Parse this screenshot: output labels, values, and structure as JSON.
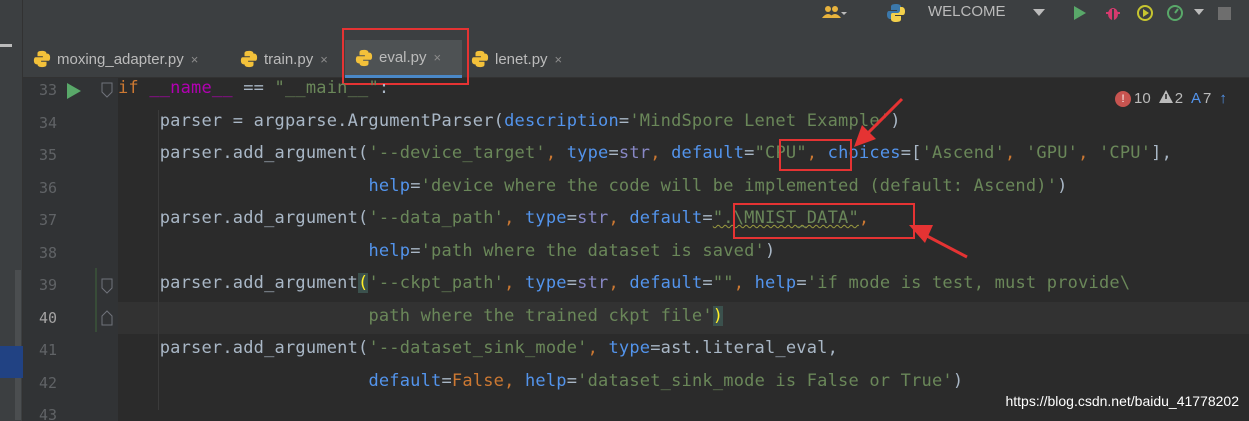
{
  "toolbar": {
    "run_config": "WELCOME"
  },
  "tabs": [
    {
      "label": "moxing_adapter.py",
      "close": "×"
    },
    {
      "label": "train.py",
      "close": "×"
    },
    {
      "label": "eval.py",
      "close": "×"
    },
    {
      "label": "lenet.py",
      "close": "×"
    }
  ],
  "inspections": {
    "errors": "10",
    "warnings": "2",
    "typos": "7"
  },
  "line_numbers": [
    "33",
    "34",
    "35",
    "36",
    "37",
    "38",
    "39",
    "40",
    "41",
    "42",
    "43"
  ],
  "code": {
    "l33": {
      "a": "if ",
      "b": "__name__",
      "c": " == ",
      "d": "\"__main__\"",
      "e": ":"
    },
    "l34": {
      "a": "    parser = argparse.ArgumentParser(",
      "b": "description",
      "c": "=",
      "d": "'MindSpore Lenet Example'",
      "e": ")"
    },
    "l35": {
      "a": "    parser.add_argument(",
      "b": "'--device_target'",
      "c": ", ",
      "d": "type",
      "e": "=",
      "f": "str",
      "g": ", ",
      "h": "default",
      "i": "=",
      "j": "\"CPU\"",
      "k": ", ",
      "l": "choices",
      "m": "=[",
      "n": "'Ascend'",
      "o": ", ",
      "p": "'GPU'",
      "q": ", ",
      "r": "'CPU'",
      "s": "],"
    },
    "l36": {
      "a": "                        ",
      "b": "help",
      "c": "=",
      "d": "'device where the code will be implemented (default: Ascend)'",
      "e": ")"
    },
    "l37": {
      "a": "    parser.add_argument(",
      "b": "'--data_path'",
      "c": ", ",
      "d": "type",
      "e": "=",
      "f": "str",
      "g": ", ",
      "h": "default",
      "i": "=",
      "j": "\".\\MNIST_DATA\"",
      "k": ","
    },
    "l38": {
      "a": "                        ",
      "b": "help",
      "c": "=",
      "d": "'path where the dataset is saved'",
      "e": ")"
    },
    "l39": {
      "a": "    parser.add_argument",
      "b": "(",
      "c": "'--ckpt_path'",
      "d": ", ",
      "e": "type",
      "f": "=",
      "g": "str",
      "h": ", ",
      "i": "default",
      "j": "=",
      "k": "\"\"",
      "l": ", ",
      "m": "help",
      "n": "=",
      "o": "'if mode is test, must provide\\"
    },
    "l40": {
      "a": "                        ",
      "b": "path where the trained ckpt file'",
      "c": ")"
    },
    "l41": {
      "a": "    parser.add_argument(",
      "b": "'--dataset_sink_mode'",
      "c": ", ",
      "d": "type",
      "e": "=ast.literal_eval,"
    },
    "l42": {
      "a": "                        ",
      "b": "default",
      "c": "=",
      "d": "False",
      "e": ", ",
      "f": "help",
      "g": "=",
      "h": "'dataset_sink_mode is False or True'",
      "i": ")"
    }
  },
  "watermark": "https://blog.csdn.net/baidu_41778202",
  "colors": {
    "editor_bg": "#2b2b2b",
    "keyword": "#cc7832",
    "string": "#6a8759",
    "param": "#aa4926",
    "annotation_red": "#e53333"
  }
}
